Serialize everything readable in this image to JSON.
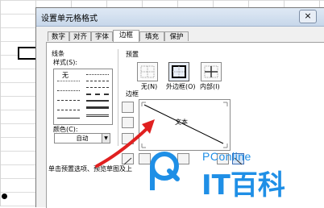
{
  "dialog": {
    "title": "设置单元格格式",
    "close_label": "×"
  },
  "tabs": [
    {
      "label": "数字",
      "active": false
    },
    {
      "label": "对齐",
      "active": false
    },
    {
      "label": "字体",
      "active": false
    },
    {
      "label": "边框",
      "active": true
    },
    {
      "label": "填充",
      "active": false
    },
    {
      "label": "保护",
      "active": false
    }
  ],
  "line_group": {
    "title": "线条",
    "style_label": "样式(S):",
    "none_label": "无",
    "color_label": "颜色(C):",
    "color_value": "自动"
  },
  "presets": {
    "title": "预置",
    "items": [
      {
        "label": "无(N)"
      },
      {
        "label": "外边框(O)"
      },
      {
        "label": "内部(I)"
      }
    ]
  },
  "border": {
    "title": "边框",
    "preview_text": "文本"
  },
  "hint_text": "单击预置选项、预览草图及上",
  "watermark": {
    "brand": "PConline",
    "text": "IT百科",
    "color": "#1f8fe6"
  },
  "colors": {
    "arrow": "#e02020",
    "title_bar": "#c7d7ea"
  }
}
